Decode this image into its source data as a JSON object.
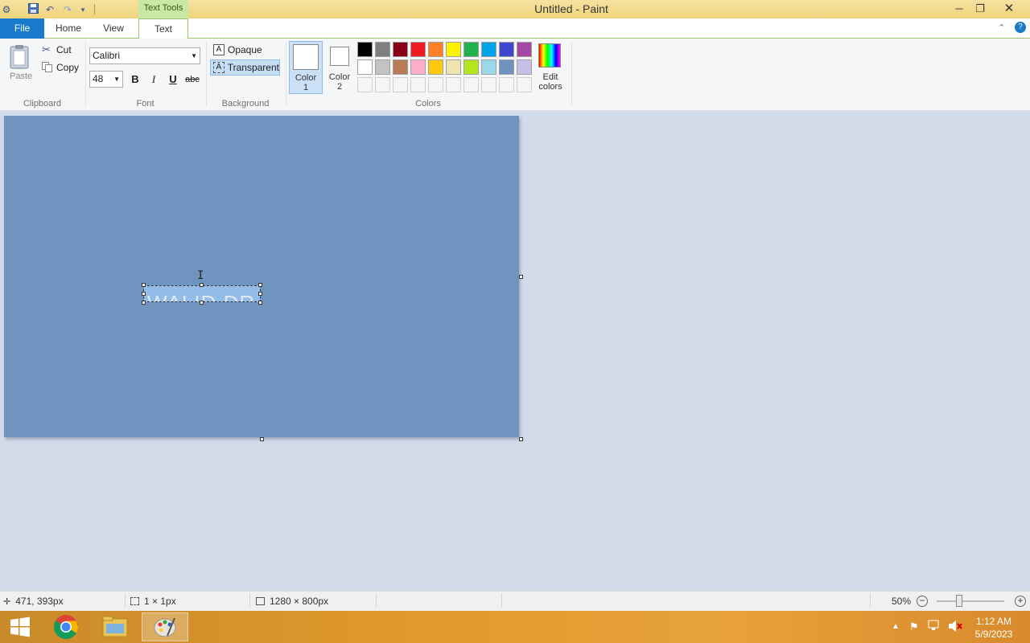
{
  "window": {
    "title": "Untitled - Paint",
    "contextual_tab": "Text Tools"
  },
  "tabs": {
    "file": "File",
    "home": "Home",
    "view": "View",
    "text": "Text"
  },
  "clipboard": {
    "paste": "Paste",
    "cut": "Cut",
    "copy": "Copy",
    "group_label": "Clipboard"
  },
  "font": {
    "family": "Calibri",
    "size": "48",
    "bold": "B",
    "italic": "I",
    "underline": "U",
    "strikethrough": "abc",
    "group_label": "Font"
  },
  "background": {
    "opaque": "Opaque",
    "transparent": "Transparent",
    "group_label": "Background"
  },
  "colors": {
    "color1_label": "Color",
    "color1_num": "1",
    "color2_label": "Color",
    "color2_num": "2",
    "edit_label": "Edit",
    "edit_label2": "colors",
    "group_label": "Colors",
    "color1_value": "#ffffff",
    "color2_value": "#ffffff",
    "palette_row1": [
      "#000000",
      "#7f7f7f",
      "#880015",
      "#ed1c24",
      "#ff7f27",
      "#fff200",
      "#22b14c",
      "#00a2e8",
      "#3f48cc",
      "#a349a4"
    ],
    "palette_row2": [
      "#ffffff",
      "#c3c3c3",
      "#b97a57",
      "#ffaec9",
      "#ffc90e",
      "#efe4b0",
      "#b5e61d",
      "#99d9ea",
      "#7092be",
      "#c8bfe7"
    ],
    "palette_row3": [
      "#f5f5f5",
      "#f5f5f5",
      "#f5f5f5",
      "#f5f5f5",
      "#f5f5f5",
      "#f5f5f5",
      "#f5f5f5",
      "#f5f5f5",
      "#f5f5f5",
      "#f5f5f5"
    ]
  },
  "canvas": {
    "background": "#7094c0",
    "text_content": "WALID DR"
  },
  "status": {
    "cursor_pos": "471, 393px",
    "selection_size": "1 × 1px",
    "image_size": "1280 × 800px",
    "zoom": "50%",
    "zoom_level": 0.5
  },
  "taskbar": {
    "time": "1:12 AM",
    "date": "5/9/2023"
  }
}
